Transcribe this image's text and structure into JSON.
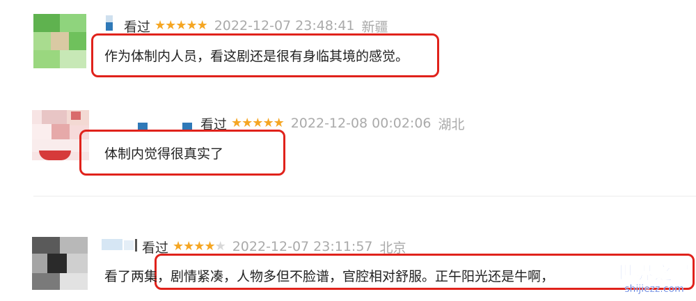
{
  "comments": [
    {
      "watched_label": "看过",
      "rating": 5,
      "time": "2022-12-07 23:48:41",
      "location": "新疆",
      "content": "作为体制内人员，看这剧还是很有身临其境的感觉。"
    },
    {
      "watched_label": "看过",
      "rating": 5,
      "time": "2022-12-08 00:02:06",
      "location": "湖北",
      "content": "体制内觉得很真实了"
    },
    {
      "watched_label": "看过",
      "rating": 4,
      "time": "2022-12-07 23:11:57",
      "location": "北京",
      "content": "看了两集，剧情紧凑，人物多但不脸谱，官腔相对舒服。正午阳光还是牛啊，"
    }
  ],
  "watermark": {
    "title": "世界之最",
    "domain": "shijiezz.com"
  },
  "colors": {
    "highlight_box": "#e0221b",
    "star": "#f5a623",
    "meta_text": "#aaaaaa",
    "watermark": "#2b57d6"
  }
}
